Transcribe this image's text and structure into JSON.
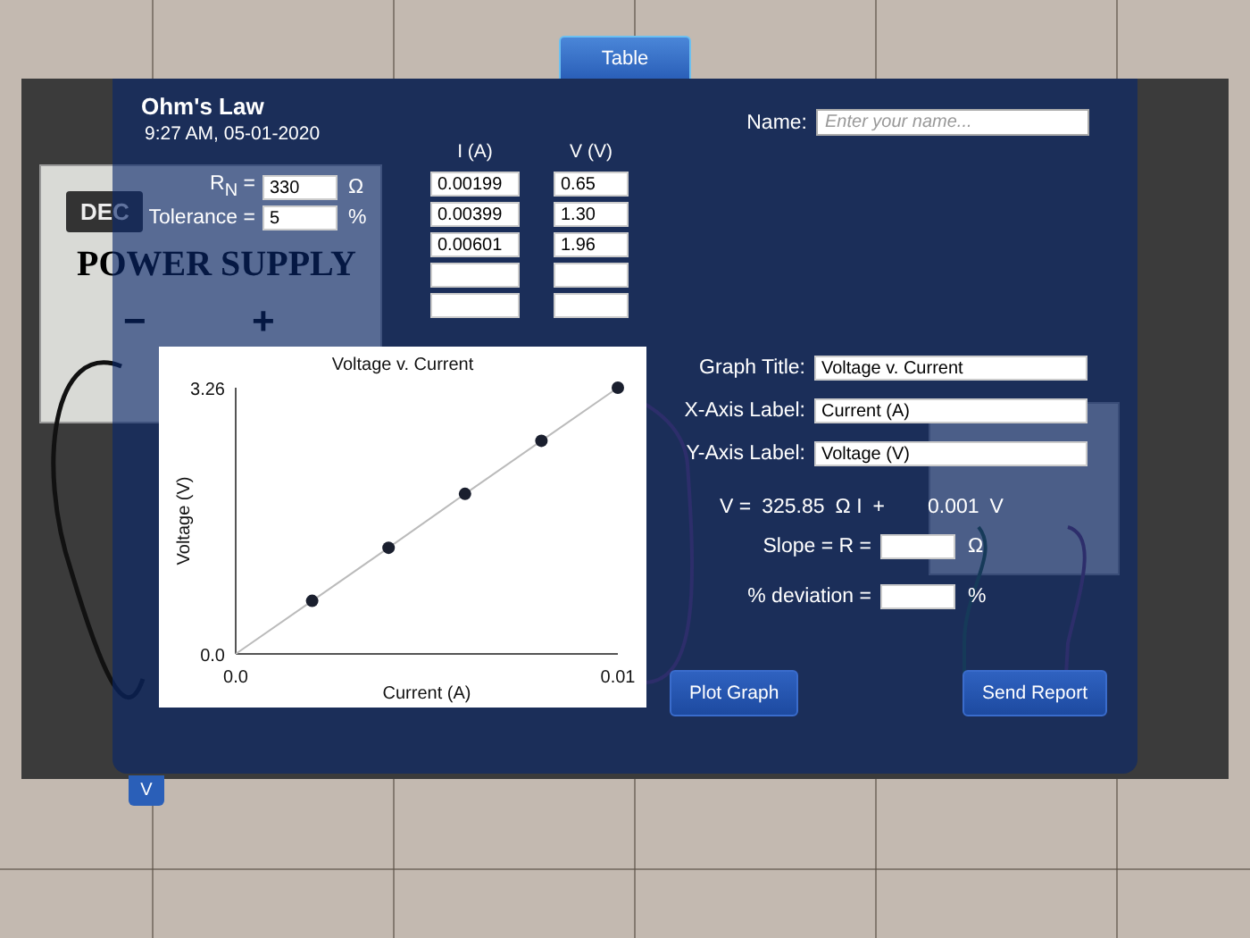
{
  "top_tab": {
    "label": "Table"
  },
  "bench": {
    "power_supply": {
      "brand": "DEC",
      "label": "POWER SUPPLY",
      "terminals": [
        "−",
        "+"
      ]
    }
  },
  "panel": {
    "title": "Ohm's Law",
    "timestamp": "9:27 AM, 05-01-2020",
    "name": {
      "label": "Name:",
      "placeholder": "Enter your name..."
    },
    "params": [
      {
        "label": "R$_{N}$ =",
        "value": "330",
        "unit": "Ω"
      },
      {
        "label": "Tolerance =",
        "value": "5",
        "unit": "%"
      }
    ],
    "table": {
      "columns": [
        "I (A)",
        "V (V)"
      ],
      "rows": [
        {
          "current": "0.00199",
          "voltage": "0.65"
        },
        {
          "current": "0.00399",
          "voltage": "1.30"
        },
        {
          "current": "0.00601",
          "voltage": "1.96"
        },
        {},
        {}
      ]
    },
    "graph": {
      "chart_data": {
        "type": "scatter",
        "title": "Voltage v. Current",
        "xlabel": "Current (A)",
        "ylabel": "Voltage (V)",
        "x": [
          0,
          0.002,
          0.004,
          0.006,
          0.008,
          0.01
        ],
        "xlim": [
          0,
          0.01
        ],
        "ylim": [
          0,
          3.26
        ],
        "xticks": [
          {
            "value": 0,
            "label": "0.0"
          },
          {
            "value": 0.01,
            "label": "0.01"
          }
        ],
        "yticks": [
          {
            "value": 0,
            "label": "0.0"
          },
          {
            "value": 3.26,
            "label": "3.26"
          }
        ],
        "series": [
          {
            "color": "#1a1f2e",
            "values": [
              null,
              0.65,
              1.3,
              1.96,
              2.61,
              3.26
            ]
          },
          {
            "type": "line",
            "color": "#bbbbbb",
            "values": [
              0,
              0.65,
              1.3,
              1.96,
              2.61,
              3.26
            ]
          }
        ]
      }
    },
    "form": [
      {
        "label": "Graph Title:",
        "value": "Voltage v. Current"
      },
      {
        "label": "X-Axis Label:",
        "value": "Current (A)"
      },
      {
        "label": "Y-Axis Label:",
        "value": "Voltage (V)"
      }
    ],
    "equation": {
      "lhs": "V =",
      "slope": "325.85",
      "slope_unit": "Ω I",
      "op": "+",
      "intercept": "0.001",
      "unit": "V"
    },
    "results": [
      {
        "label": "Slope = R =",
        "unit": "Ω"
      },
      {
        "label": "% deviation =",
        "unit": "%"
      }
    ],
    "buttons": [
      "Plot Graph",
      "Send Report"
    ]
  },
  "collapse_button": {
    "label": "V"
  }
}
